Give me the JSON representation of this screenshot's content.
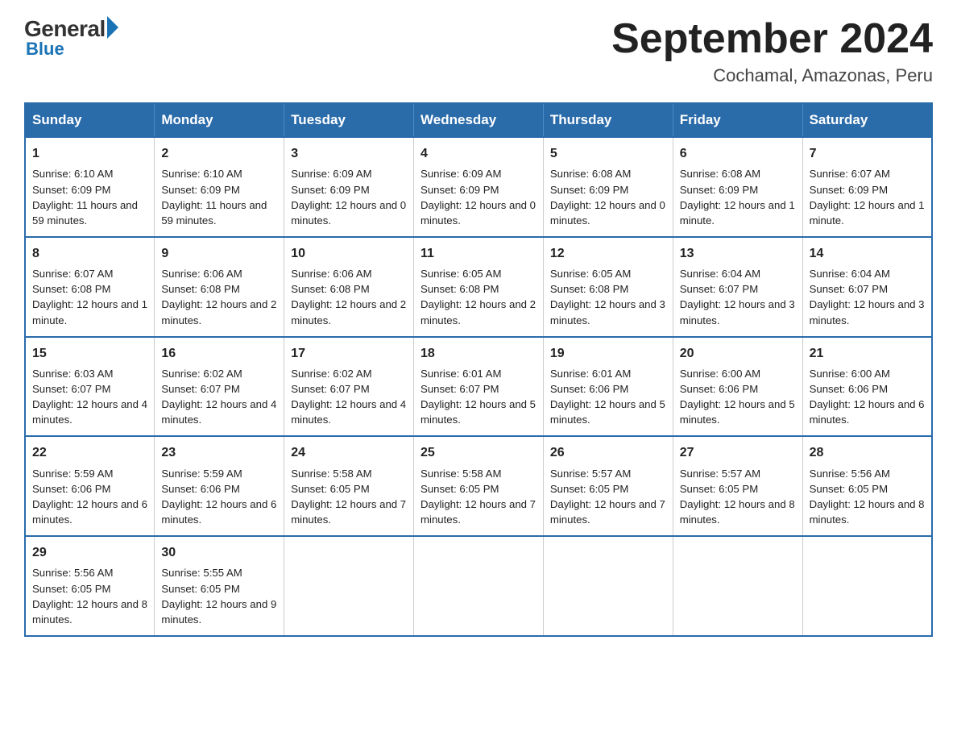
{
  "logo": {
    "general": "General",
    "blue": "Blue"
  },
  "title": {
    "month_year": "September 2024",
    "location": "Cochamal, Amazonas, Peru"
  },
  "headers": [
    "Sunday",
    "Monday",
    "Tuesday",
    "Wednesday",
    "Thursday",
    "Friday",
    "Saturday"
  ],
  "weeks": [
    [
      {
        "day": "1",
        "sunrise": "6:10 AM",
        "sunset": "6:09 PM",
        "daylight": "11 hours and 59 minutes."
      },
      {
        "day": "2",
        "sunrise": "6:10 AM",
        "sunset": "6:09 PM",
        "daylight": "11 hours and 59 minutes."
      },
      {
        "day": "3",
        "sunrise": "6:09 AM",
        "sunset": "6:09 PM",
        "daylight": "12 hours and 0 minutes."
      },
      {
        "day": "4",
        "sunrise": "6:09 AM",
        "sunset": "6:09 PM",
        "daylight": "12 hours and 0 minutes."
      },
      {
        "day": "5",
        "sunrise": "6:08 AM",
        "sunset": "6:09 PM",
        "daylight": "12 hours and 0 minutes."
      },
      {
        "day": "6",
        "sunrise": "6:08 AM",
        "sunset": "6:09 PM",
        "daylight": "12 hours and 1 minute."
      },
      {
        "day": "7",
        "sunrise": "6:07 AM",
        "sunset": "6:09 PM",
        "daylight": "12 hours and 1 minute."
      }
    ],
    [
      {
        "day": "8",
        "sunrise": "6:07 AM",
        "sunset": "6:08 PM",
        "daylight": "12 hours and 1 minute."
      },
      {
        "day": "9",
        "sunrise": "6:06 AM",
        "sunset": "6:08 PM",
        "daylight": "12 hours and 2 minutes."
      },
      {
        "day": "10",
        "sunrise": "6:06 AM",
        "sunset": "6:08 PM",
        "daylight": "12 hours and 2 minutes."
      },
      {
        "day": "11",
        "sunrise": "6:05 AM",
        "sunset": "6:08 PM",
        "daylight": "12 hours and 2 minutes."
      },
      {
        "day": "12",
        "sunrise": "6:05 AM",
        "sunset": "6:08 PM",
        "daylight": "12 hours and 3 minutes."
      },
      {
        "day": "13",
        "sunrise": "6:04 AM",
        "sunset": "6:07 PM",
        "daylight": "12 hours and 3 minutes."
      },
      {
        "day": "14",
        "sunrise": "6:04 AM",
        "sunset": "6:07 PM",
        "daylight": "12 hours and 3 minutes."
      }
    ],
    [
      {
        "day": "15",
        "sunrise": "6:03 AM",
        "sunset": "6:07 PM",
        "daylight": "12 hours and 4 minutes."
      },
      {
        "day": "16",
        "sunrise": "6:02 AM",
        "sunset": "6:07 PM",
        "daylight": "12 hours and 4 minutes."
      },
      {
        "day": "17",
        "sunrise": "6:02 AM",
        "sunset": "6:07 PM",
        "daylight": "12 hours and 4 minutes."
      },
      {
        "day": "18",
        "sunrise": "6:01 AM",
        "sunset": "6:07 PM",
        "daylight": "12 hours and 5 minutes."
      },
      {
        "day": "19",
        "sunrise": "6:01 AM",
        "sunset": "6:06 PM",
        "daylight": "12 hours and 5 minutes."
      },
      {
        "day": "20",
        "sunrise": "6:00 AM",
        "sunset": "6:06 PM",
        "daylight": "12 hours and 5 minutes."
      },
      {
        "day": "21",
        "sunrise": "6:00 AM",
        "sunset": "6:06 PM",
        "daylight": "12 hours and 6 minutes."
      }
    ],
    [
      {
        "day": "22",
        "sunrise": "5:59 AM",
        "sunset": "6:06 PM",
        "daylight": "12 hours and 6 minutes."
      },
      {
        "day": "23",
        "sunrise": "5:59 AM",
        "sunset": "6:06 PM",
        "daylight": "12 hours and 6 minutes."
      },
      {
        "day": "24",
        "sunrise": "5:58 AM",
        "sunset": "6:05 PM",
        "daylight": "12 hours and 7 minutes."
      },
      {
        "day": "25",
        "sunrise": "5:58 AM",
        "sunset": "6:05 PM",
        "daylight": "12 hours and 7 minutes."
      },
      {
        "day": "26",
        "sunrise": "5:57 AM",
        "sunset": "6:05 PM",
        "daylight": "12 hours and 7 minutes."
      },
      {
        "day": "27",
        "sunrise": "5:57 AM",
        "sunset": "6:05 PM",
        "daylight": "12 hours and 8 minutes."
      },
      {
        "day": "28",
        "sunrise": "5:56 AM",
        "sunset": "6:05 PM",
        "daylight": "12 hours and 8 minutes."
      }
    ],
    [
      {
        "day": "29",
        "sunrise": "5:56 AM",
        "sunset": "6:05 PM",
        "daylight": "12 hours and 8 minutes."
      },
      {
        "day": "30",
        "sunrise": "5:55 AM",
        "sunset": "6:05 PM",
        "daylight": "12 hours and 9 minutes."
      },
      null,
      null,
      null,
      null,
      null
    ]
  ]
}
